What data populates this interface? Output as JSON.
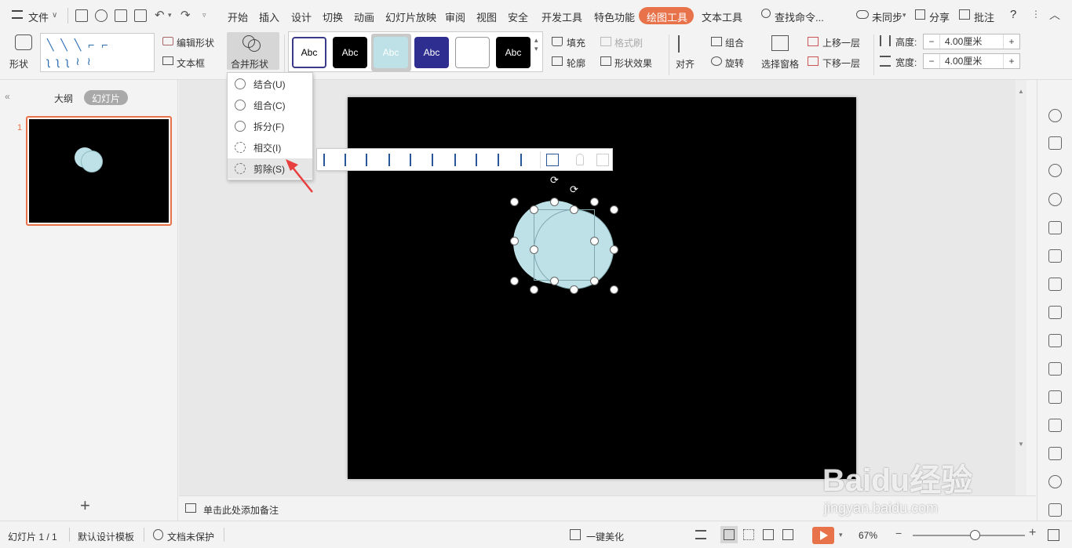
{
  "menubar": {
    "file": "文件",
    "tabs": [
      "开始",
      "插入",
      "设计",
      "切换",
      "动画",
      "幻灯片放映",
      "审阅",
      "视图",
      "安全",
      "开发工具",
      "特色功能",
      "绘图工具",
      "文本工具"
    ],
    "search": "查找命令...",
    "sync": "未同步",
    "share": "分享",
    "comment": "批注",
    "help": "?"
  },
  "ribbon": {
    "shape": "形状",
    "edit_shape": "编辑形状",
    "textbox": "文本框",
    "merge_shape": "合并形状",
    "styles": [
      "Abc",
      "Abc",
      "Abc",
      "Abc",
      "",
      "Abc"
    ],
    "fill": "填充",
    "format_painter": "格式刷",
    "outline": "轮廓",
    "shape_effect": "形状效果",
    "align": "对齐",
    "group": "组合",
    "rotate": "旋转",
    "select_pane": "选择窗格",
    "bring_forward": "上移一层",
    "send_backward": "下移一层",
    "height_label": "高度:",
    "height_value": "4.00厘米",
    "width_label": "宽度:",
    "width_value": "4.00厘米",
    "minus": "−",
    "plus": "+"
  },
  "dropdown": {
    "items": [
      "结合(U)",
      "组合(C)",
      "拆分(F)",
      "相交(I)",
      "剪除(S)"
    ]
  },
  "leftpane": {
    "outline_tab": "大纲",
    "slides_tab": "幻灯片",
    "slide_number": "1",
    "add": "+"
  },
  "notes": {
    "placeholder": "单击此处添加备注"
  },
  "status": {
    "slide_count": "幻灯片 1 / 1",
    "template": "默认设计模板",
    "protect": "文档未保护",
    "beautify": "一键美化",
    "zoom": "67%",
    "zoom_fraction": 0.55
  },
  "watermark": {
    "brand": "Baidu经验",
    "url": "jingyan.baidu.com"
  },
  "colors": {
    "accent": "#e8734a",
    "shape_fill": "#bde1e6",
    "arrow": "#e83e3e"
  }
}
